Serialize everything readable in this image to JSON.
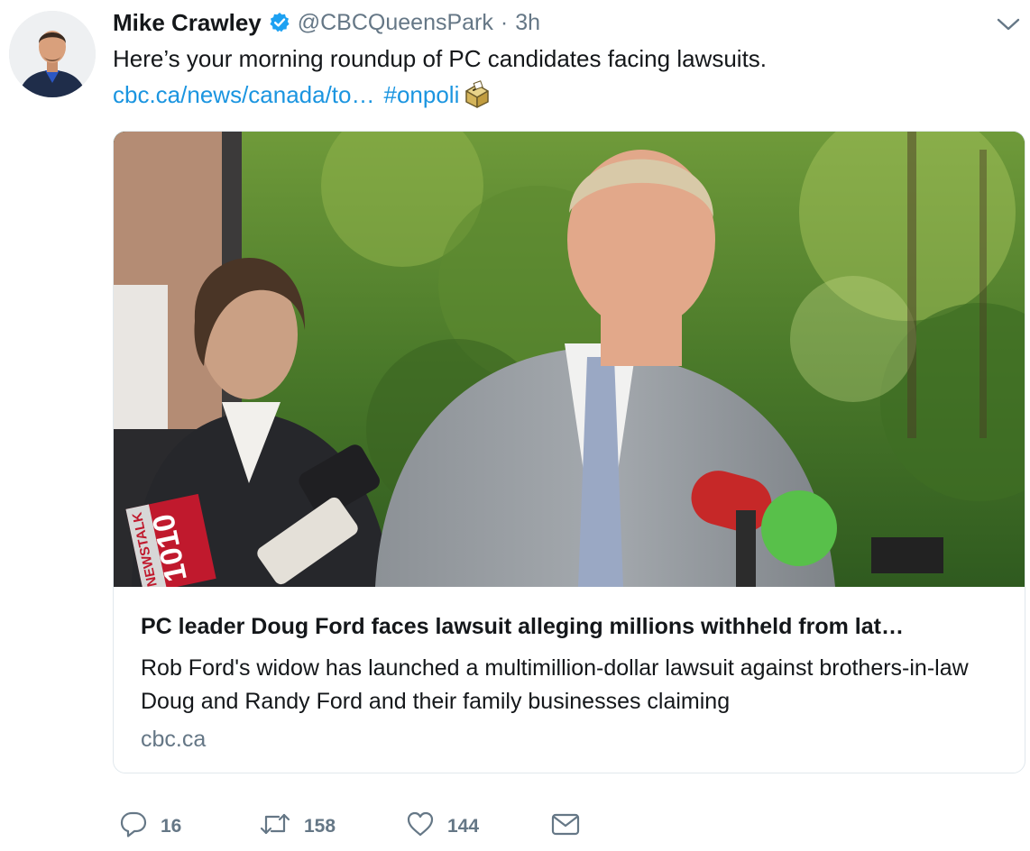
{
  "tweet": {
    "author_name": "Mike Crawley",
    "handle": "@CBCQueensPark",
    "separator": "·",
    "time": "3h",
    "text": "Here’s your morning roundup of PC candidates facing lawsuits.",
    "link_text": "cbc.ca/news/canada/to…",
    "hashtag": "#onpoli",
    "emoji": "ballot-box-icon"
  },
  "card": {
    "title": "PC leader Doug Ford faces lawsuit alleging millions withheld from lat…",
    "description": "Rob Ford's widow has launched a multimillion-dollar lawsuit against brothers-in-law Doug and Randy Ford and their family businesses claiming",
    "domain": "cbc.ca",
    "image": {
      "mic_sign_station": "NEWSTALK",
      "mic_sign_number": "1010"
    }
  },
  "actions": {
    "reply_count": "16",
    "retweet_count": "158",
    "like_count": "144",
    "icons": [
      "reply-icon",
      "retweet-icon",
      "like-icon",
      "dm-icon"
    ]
  },
  "colors": {
    "link": "#1b95e0",
    "verified": "#1da1f2",
    "muted": "#657786",
    "text": "#14171a"
  }
}
